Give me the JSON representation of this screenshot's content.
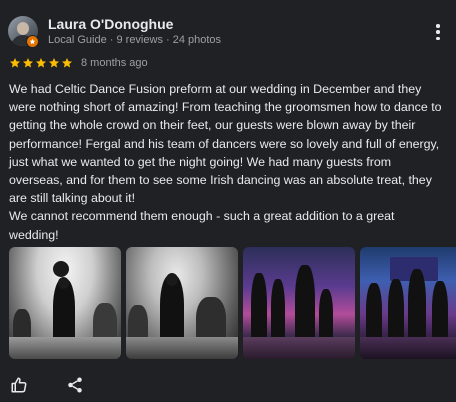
{
  "reviewer": {
    "name": "Laura O'Donoghue",
    "meta": "Local Guide · 9 reviews · 24 photos"
  },
  "rating": {
    "stars": 5,
    "max_stars": 5,
    "time": "8 months ago",
    "star_color": "#fbbc04"
  },
  "review_text": "We had Celtic Dance Fusion preform at our wedding in December and they were nothing short of amazing! From teaching the groomsmen how to dance to getting the whole crowd on their feet, our guests were blown away by their performance! Fergal and his team of dancers were so lovely and full of energy, just what we wanted to get the night going! We had many guests from overseas, and for them to see some Irish dancing was an absolute treat, they are still talking about it!\nWe cannot recommend them enough - such a great addition to a great wedding!",
  "photos": [
    {
      "style": "black-and-white",
      "subject": "irish-dancer"
    },
    {
      "style": "black-and-white",
      "subject": "irish-dancer"
    },
    {
      "style": "color",
      "subject": "dancers-on-stage"
    },
    {
      "style": "color",
      "subject": "dancers-on-stage"
    }
  ],
  "actions": {
    "like_icon": "thumbs-up-icon",
    "share_icon": "share-icon"
  },
  "colors": {
    "background": "#202124",
    "text_primary": "#e8eaed",
    "text_secondary": "#9aa0a6",
    "local_guide_badge": "#e37400"
  }
}
